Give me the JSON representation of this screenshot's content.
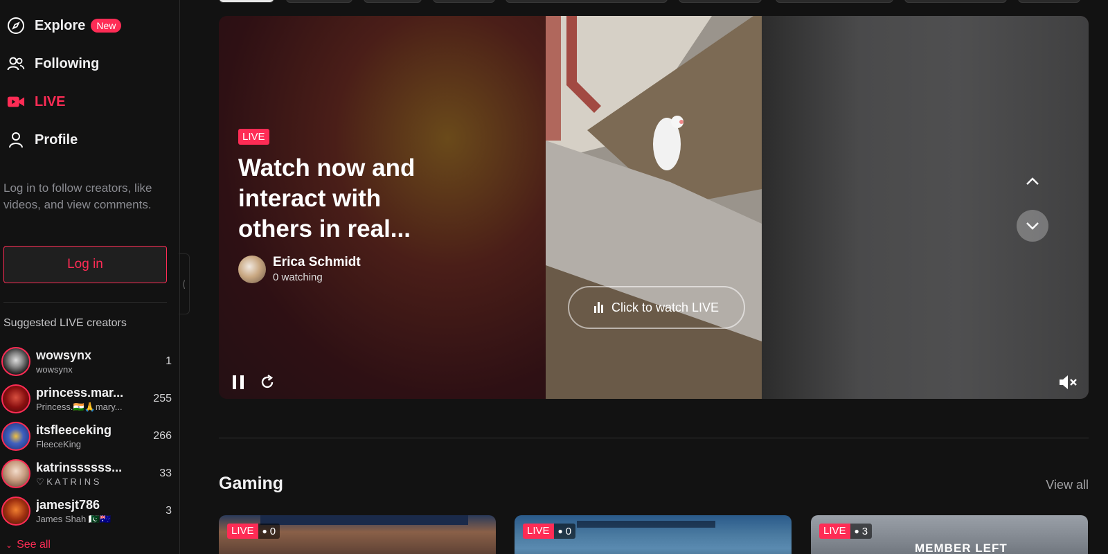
{
  "nav": {
    "explore": "Explore",
    "explore_badge": "New",
    "following": "Following",
    "live": "LIVE",
    "profile": "Profile"
  },
  "login": {
    "hint": "Log in to follow creators, like videos, and view comments.",
    "button": "Log in"
  },
  "suggested": {
    "title": "Suggested LIVE creators",
    "creators": [
      {
        "username": "wowsynx",
        "display": "wowsynx",
        "count": "1"
      },
      {
        "username": "princess.mar...",
        "display": "Princess.🇮🇳🙏mary...",
        "count": "255"
      },
      {
        "username": "itsfleeceking",
        "display": "FleeceKing",
        "count": "266"
      },
      {
        "username": "katrinssssss...",
        "display": "♡ K A T R I N S",
        "count": "33"
      },
      {
        "username": "jamesjt786",
        "display": "James Shah 🇵🇰🇦🇺",
        "count": "3"
      }
    ],
    "see_all": "See all"
  },
  "hero": {
    "live_tag": "LIVE",
    "title": "Watch now and interact with others in real...",
    "host_name": "Erica Schmidt",
    "host_watching": "0 watching",
    "watch_button": "Click to watch LIVE"
  },
  "gaming": {
    "title": "Gaming",
    "view_all": "View all",
    "cards": [
      {
        "live": "LIVE",
        "viewers": "0"
      },
      {
        "live": "LIVE",
        "viewers": "0"
      },
      {
        "live": "LIVE",
        "viewers": "3",
        "overlay_text": "MEMBER LEFT"
      }
    ]
  },
  "colors": {
    "accent": "#fe2c55",
    "background": "#121212"
  }
}
